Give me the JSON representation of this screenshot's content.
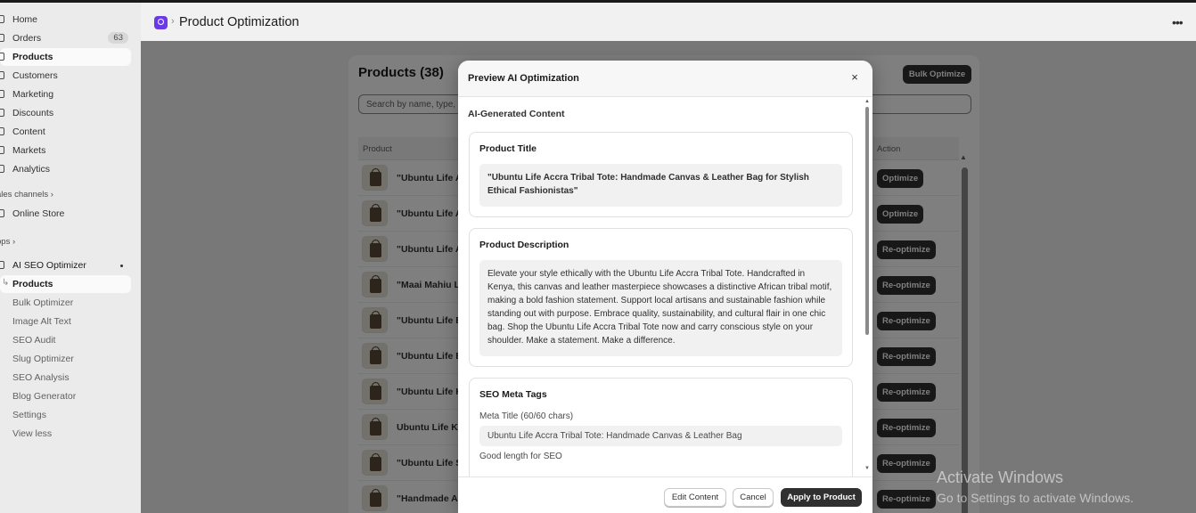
{
  "sidebar": {
    "nav": [
      {
        "label": "Home",
        "icon": "home-icon"
      },
      {
        "label": "Orders",
        "icon": "orders-icon",
        "badge": "63"
      },
      {
        "label": "Products",
        "icon": "tag-icon"
      },
      {
        "label": "Customers",
        "icon": "person-icon"
      },
      {
        "label": "Marketing",
        "icon": "target-icon"
      },
      {
        "label": "Discounts",
        "icon": "discount-icon"
      },
      {
        "label": "Content",
        "icon": "content-icon"
      },
      {
        "label": "Markets",
        "icon": "globe-icon"
      },
      {
        "label": "Analytics",
        "icon": "chart-icon"
      }
    ],
    "sales_channels_label": "ales channels ›",
    "online_store_label": "Online Store",
    "apps_label": "pps ›",
    "app_name": "AI SEO Optimizer",
    "app_sub_items": [
      "Products",
      "Bulk Optimizer",
      "Image Alt Text",
      "SEO Audit",
      "Slug Optimizer",
      "SEO Analysis",
      "Blog Generator",
      "Settings",
      "View less"
    ]
  },
  "header": {
    "breadcrumb_sep": "›",
    "title": "Product Optimization",
    "more_icon": "more-horizontal-icon"
  },
  "products_page": {
    "title": "Products (38)",
    "bulk_button": "Bulk Optimize",
    "search_placeholder": "Search by name, type, or vendor...",
    "columns": {
      "product": "Product",
      "action": "Action"
    },
    "rows": [
      {
        "name": "\"Ubuntu Life Accra Tribal Tote: Handmade Canvas & Leather Bag\"",
        "action": "Optimize"
      },
      {
        "name": "\"Ubuntu Life Accra Tribal Tote: Handmade Canvas & Leather Bag\"",
        "action": "Optimize"
      },
      {
        "name": "\"Ubuntu Life Accra Tribal Tote: Handmade Canvas & Leather Bag\"",
        "action": "Re-optimize"
      },
      {
        "name": "\"Maai Mahiu Leather Clutch: Handcrafted Kenyan Style\"",
        "action": "Re-optimize"
      },
      {
        "name": "\"Ubuntu Life Batik Tote: Handmade Canvas Bag\"",
        "action": "Re-optimize"
      },
      {
        "name": "\"Ubuntu Life Batik Shopper: Handmade Canvas Bag\"",
        "action": "Re-optimize"
      },
      {
        "name": "\"Ubuntu Life Kitenge Tote: Handmade Canvas Bag\"",
        "action": "Re-optimize"
      },
      {
        "name": "Ubuntu Life Kuwait Tote: Handmade Canvas Bag",
        "action": "Re-optimize"
      },
      {
        "name": "\"Ubuntu Life Sisal Tote: Handmade Canvas Bag\"",
        "action": "Re-optimize"
      },
      {
        "name": "\"Handmade Ankara Backpack: Colorful African Print\"",
        "action": "Re-optimize"
      }
    ]
  },
  "modal": {
    "title": "Preview AI Optimization",
    "close_label": "×",
    "heading": "AI-Generated Content",
    "product_title_label": "Product Title",
    "product_title_value": "\"Ubuntu Life Accra Tribal Tote: Handmade Canvas & Leather Bag for Stylish Ethical Fashionistas\"",
    "description_label": "Product Description",
    "description_value": "Elevate your style ethically with the Ubuntu Life Accra Tribal Tote. Handcrafted in Kenya, this canvas and leather masterpiece showcases a distinctive African tribal motif, making a bold fashion statement. Support local artisans and sustainable fashion while standing out with purpose. Embrace quality, sustainability, and cultural flair in one chic bag. Shop the Ubuntu Life Accra Tribal Tote now and carry conscious style on your shoulder. Make a statement. Make a difference.",
    "seo_label": "SEO Meta Tags",
    "meta_title_label": "Meta Title (60/60 chars)",
    "meta_title_value": "Ubuntu Life Accra Tribal Tote: Handmade Canvas & Leather Bag",
    "meta_title_hint": "Good length for SEO",
    "edit_button": "Edit Content",
    "cancel_button": "Cancel",
    "apply_button": "Apply to Product"
  },
  "watermark": {
    "line1": "Activate Windows",
    "line2": "Go to Settings to activate Windows."
  }
}
